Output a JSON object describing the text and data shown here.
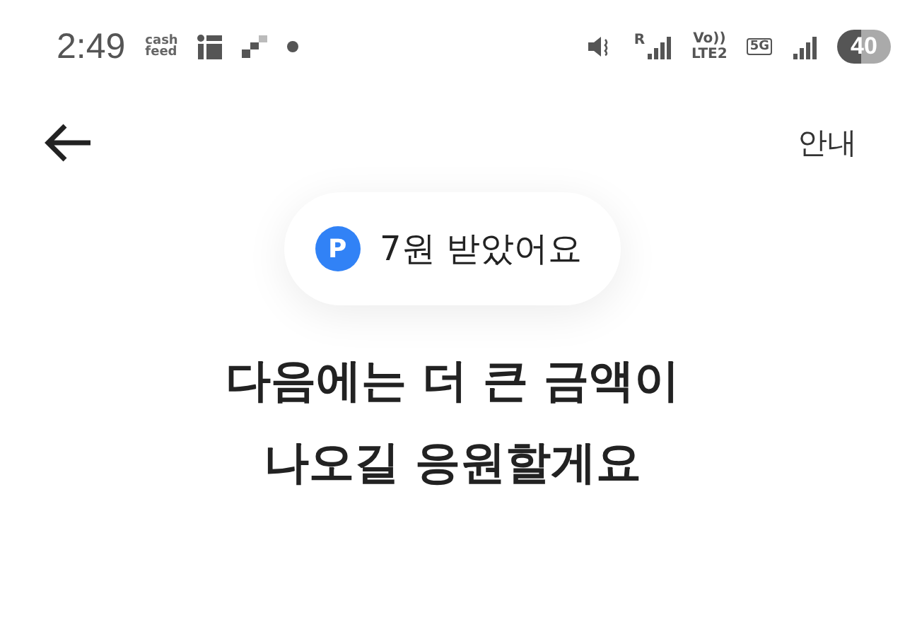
{
  "status_bar": {
    "time": "2:49",
    "notification_logo": "cash feed",
    "roaming": "R",
    "volte": "Vo))",
    "lte": "LTE2",
    "network": "5G",
    "battery": "40"
  },
  "header": {
    "help_link": "안내"
  },
  "reward_badge": {
    "icon_letter": "P",
    "text": "7원 받았어요"
  },
  "message": [
    "다음에는 더 큰 금액이",
    "나오길 응원할게요"
  ]
}
